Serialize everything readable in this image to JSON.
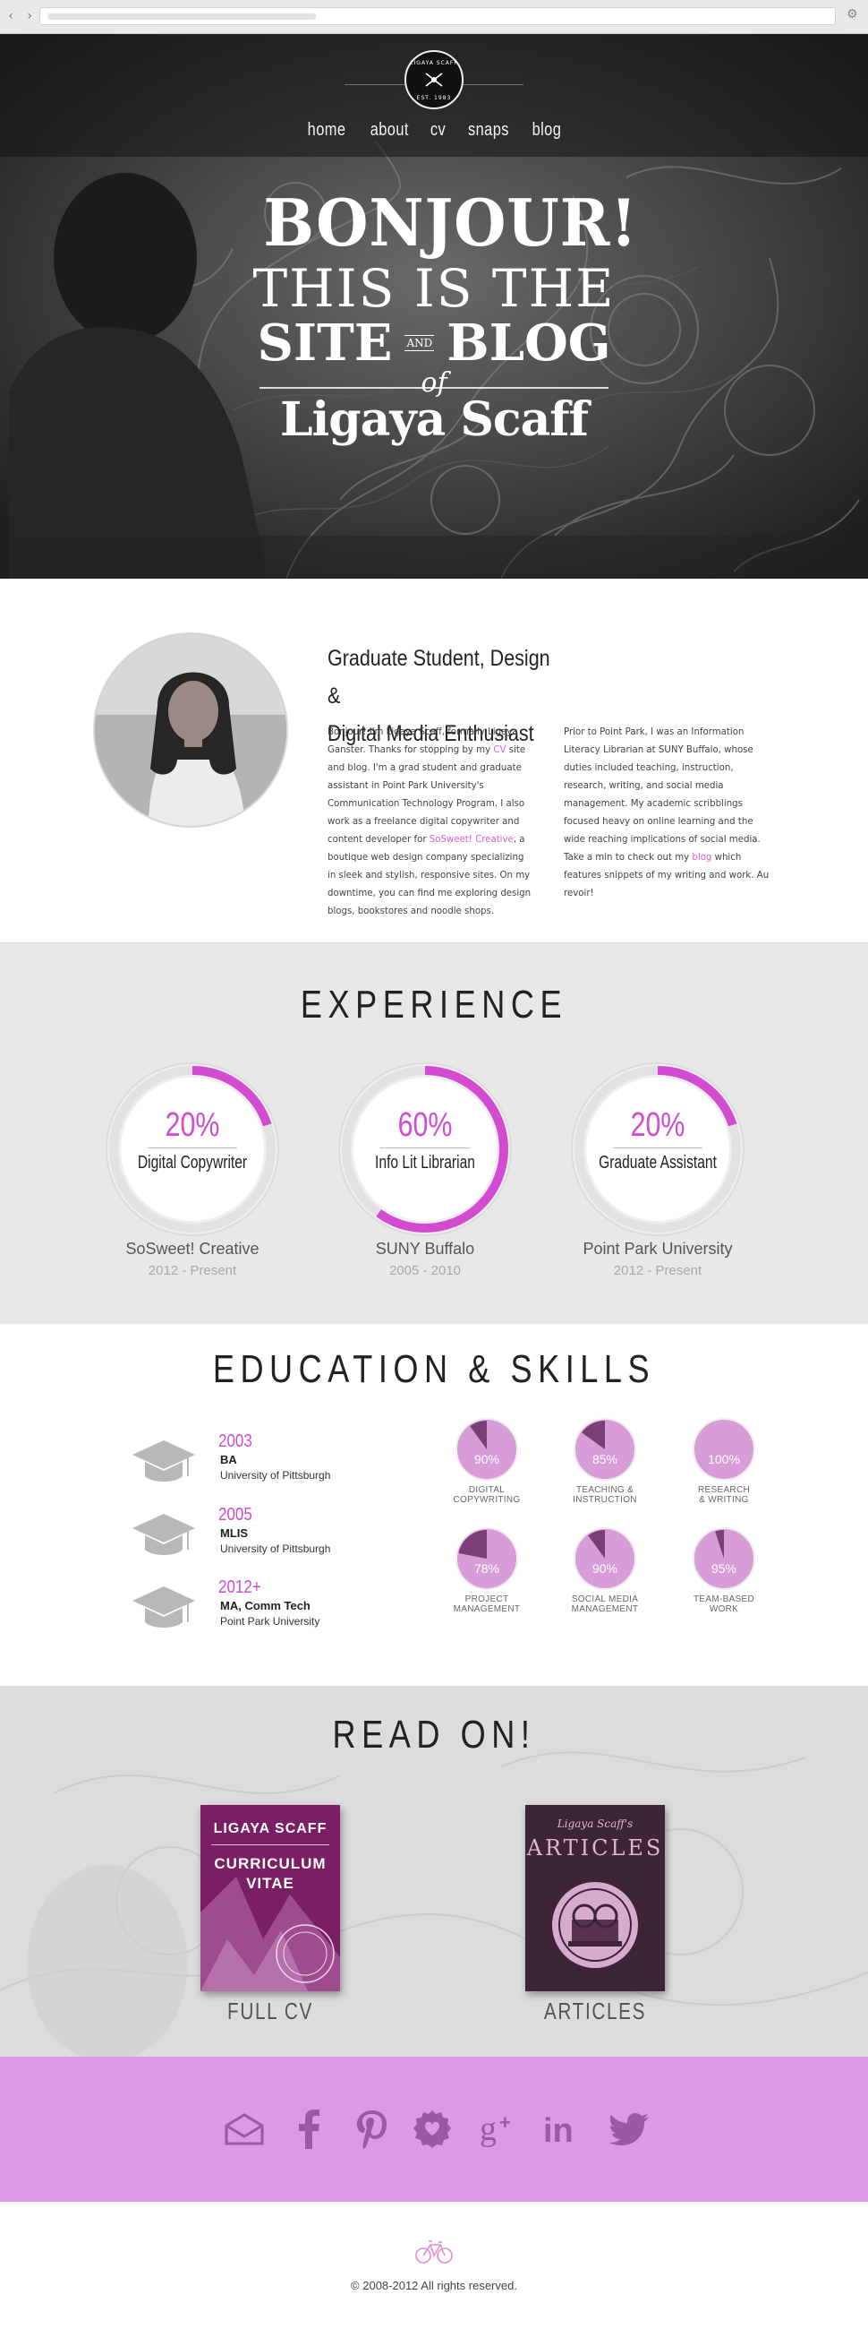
{
  "nav": {
    "items": [
      {
        "label": "home"
      },
      {
        "label": "about"
      },
      {
        "label": "cv"
      },
      {
        "label": "snaps"
      },
      {
        "label": "blog"
      }
    ]
  },
  "badge": {
    "top_text": "LIGAYA SCAFF",
    "bottom_text": "EST. 1983"
  },
  "hero": {
    "line1": "BONJOUR!",
    "line2": "THIS IS THE",
    "site": "SITE",
    "and": "AND",
    "blog": "BLOG",
    "of": "of",
    "name": "Ligaya Scaff"
  },
  "about": {
    "title_line1": "Graduate Student, Design &",
    "title_line2": "Digital Media Enthusiast",
    "p1_before_cv": "Bonjour! I'm Ligaya Scaff, formally Ligaya Ganster. Thanks for stopping by my ",
    "p1_cv": "CV",
    "p1_after_cv": " site and blog. I'm a grad student and graduate assistant in Point Park University's Communication Technology Program. I also work as a freelance digital copywriter and content developer for ",
    "p1_link": "SoSweet! Creative",
    "p1_end": ", a boutique web design company specializing in sleek and stylish, responsive sites. On my downtime, you can find me exploring design blogs, bookstores and noodle shops.",
    "p2_before": "Prior to Point Park, I was an Information Literacy Librarian at SUNY Buffalo, whose duties included teaching, instruction, research, writing, and social media management. My academic scribblings focused heavy on online learning and the wide reaching implications of social media. Take a min to check out my ",
    "p2_link": "blog",
    "p2_after": " which features snippets of my writing and work. Au revoir!"
  },
  "experience": {
    "title": "EXPERIENCE",
    "items": [
      {
        "percent": "20%",
        "value": 20,
        "role": "Digital Copywriter",
        "company": "SoSweet! Creative",
        "dates": "2012 - Present"
      },
      {
        "percent": "60%",
        "value": 60,
        "role": "Info Lit Librarian",
        "company": "SUNY Buffalo",
        "dates": "2005 - 2010"
      },
      {
        "percent": "20%",
        "value": 20,
        "role": "Graduate Assistant",
        "company": "Point Park University",
        "dates": "2012 - Present"
      }
    ]
  },
  "education": {
    "title": "EDUCATION & SKILLS",
    "degrees": [
      {
        "year": "2003",
        "degree": "BA",
        "school": "University of Pittsburgh"
      },
      {
        "year": "2005",
        "degree": "MLIS",
        "school": "University of Pittsburgh"
      },
      {
        "year": "2012+",
        "degree": "MA, Comm Tech",
        "school": "Point Park University"
      }
    ],
    "skills": [
      {
        "percent": "90%",
        "value": 90,
        "line1": "DIGITAL",
        "line2": "COPYWRITING"
      },
      {
        "percent": "85%",
        "value": 85,
        "line1": "TEACHING &",
        "line2": "INSTRUCTION"
      },
      {
        "percent": "100%",
        "value": 100,
        "line1": "RESEARCH",
        "line2": "& WRITING"
      },
      {
        "percent": "78%",
        "value": 78,
        "line1": "PROJECT",
        "line2": "MANAGEMENT"
      },
      {
        "percent": "90%",
        "value": 90,
        "line1": "SOCIAL MEDIA",
        "line2": "MANAGEMENT"
      },
      {
        "percent": "95%",
        "value": 95,
        "line1": "TEAM-BASED",
        "line2": "WORK"
      }
    ]
  },
  "readon": {
    "title": "READ ON!",
    "cv_book": {
      "line1": "LIGAYA SCAFF",
      "line2": "CURRICULUM",
      "line3": "VITAE",
      "label": "FULL CV"
    },
    "articles_book": {
      "line1": "Ligaya Scaff's",
      "line2": "ARTICLES",
      "label": "ARTICLES"
    }
  },
  "social": {
    "icons": [
      "mail-icon",
      "facebook-icon",
      "pinterest-icon",
      "dribbble-icon",
      "google-plus-icon",
      "linkedin-icon",
      "twitter-icon"
    ],
    "color": "#9c57a6"
  },
  "footer": {
    "copyright": "© 2008-2012 All rights reserved."
  },
  "colors": {
    "accent": "#d24bd0",
    "social_bg": "#dc99e6",
    "book_cv": "#7a1f63",
    "book_articles": "#3d2436"
  }
}
